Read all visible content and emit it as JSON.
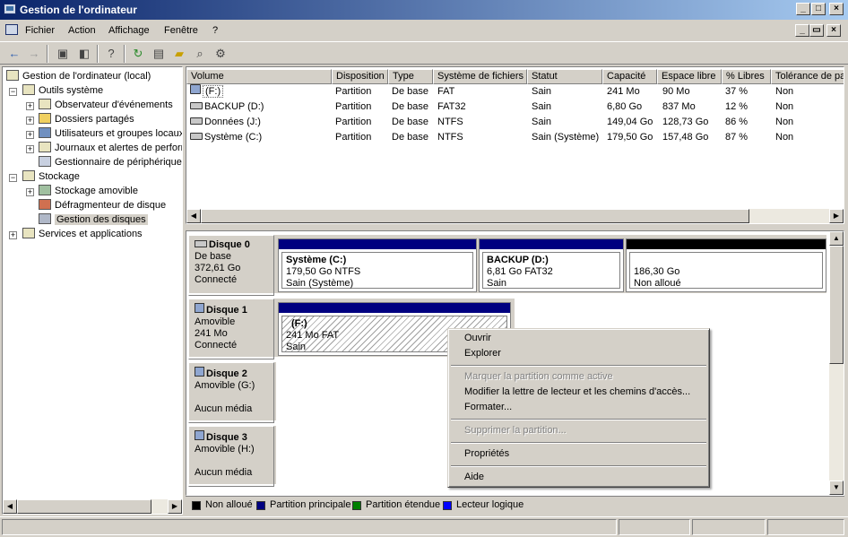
{
  "window": {
    "title": "Gestion de l'ordinateur"
  },
  "menu": {
    "items": [
      "Fichier",
      "Action",
      "Affichage",
      "Fenêtre",
      "?"
    ]
  },
  "tree": {
    "root": "Gestion de l'ordinateur (local)",
    "items": [
      "Outils système",
      "Observateur d'événements",
      "Dossiers partagés",
      "Utilisateurs et groupes locaux",
      "Journaux et alertes de performance",
      "Gestionnaire de périphériques",
      "Stockage",
      "Stockage amovible",
      "Défragmenteur de disque",
      "Gestion des disques",
      "Services et applications"
    ]
  },
  "volumes": {
    "columns": [
      "Volume",
      "Disposition",
      "Type",
      "Système de fichiers",
      "Statut",
      "Capacité",
      "Espace libre",
      "% Libres",
      "Tolérance de pannes"
    ],
    "rows": [
      [
        "(F:)",
        "Partition",
        "De base",
        "FAT",
        "Sain",
        "241 Mo",
        "90 Mo",
        "37 %",
        "Non"
      ],
      [
        "BACKUP (D:)",
        "Partition",
        "De base",
        "FAT32",
        "Sain",
        "6,80 Go",
        "837 Mo",
        "12 %",
        "Non"
      ],
      [
        "Données (J:)",
        "Partition",
        "De base",
        "NTFS",
        "Sain",
        "149,04 Go",
        "128,73 Go",
        "86 %",
        "Non"
      ],
      [
        "Système (C:)",
        "Partition",
        "De base",
        "NTFS",
        "Sain (Système)",
        "179,50 Go",
        "157,48 Go",
        "87 %",
        "Non"
      ]
    ]
  },
  "disks": [
    {
      "name": "Disque 0",
      "type": "De base",
      "size": "372,61 Go",
      "state": "Connecté",
      "partitions": [
        {
          "name": "Système  (C:)",
          "detail": "179,50 Go NTFS",
          "status": "Sain (Système)"
        },
        {
          "name": "BACKUP  (D:)",
          "detail": "6,81 Go FAT32",
          "status": "Sain"
        },
        {
          "name": "",
          "detail": "186,30 Go",
          "status": "Non alloué"
        }
      ]
    },
    {
      "name": "Disque 1",
      "type": "Amovible",
      "size": "241 Mo",
      "state": "Connecté",
      "partitions": [
        {
          "name": "(F:)",
          "detail": "241 Mo FAT",
          "status": "Sain"
        }
      ]
    },
    {
      "name": "Disque 2",
      "type": "Amovible (G:)",
      "state": "Aucun média"
    },
    {
      "name": "Disque 3",
      "type": "Amovible (H:)",
      "state": "Aucun média"
    }
  ],
  "legend": [
    {
      "label": "Non alloué",
      "color": "#000000"
    },
    {
      "label": "Partition principale",
      "color": "#000080"
    },
    {
      "label": "Partition étendue",
      "color": "#008000"
    },
    {
      "label": "Lecteur logique",
      "color": "#0000ff"
    }
  ],
  "context_menu": {
    "open": "Ouvrir",
    "explore": "Explorer",
    "mark_active": "Marquer la partition comme active",
    "change_letter": "Modifier la lettre de lecteur et les chemins d'accès...",
    "format": "Formater...",
    "delete": "Supprimer la partition...",
    "properties": "Propriétés",
    "help": "Aide"
  },
  "colors": {
    "primary_partition": "#000080",
    "unallocated": "#000000"
  }
}
